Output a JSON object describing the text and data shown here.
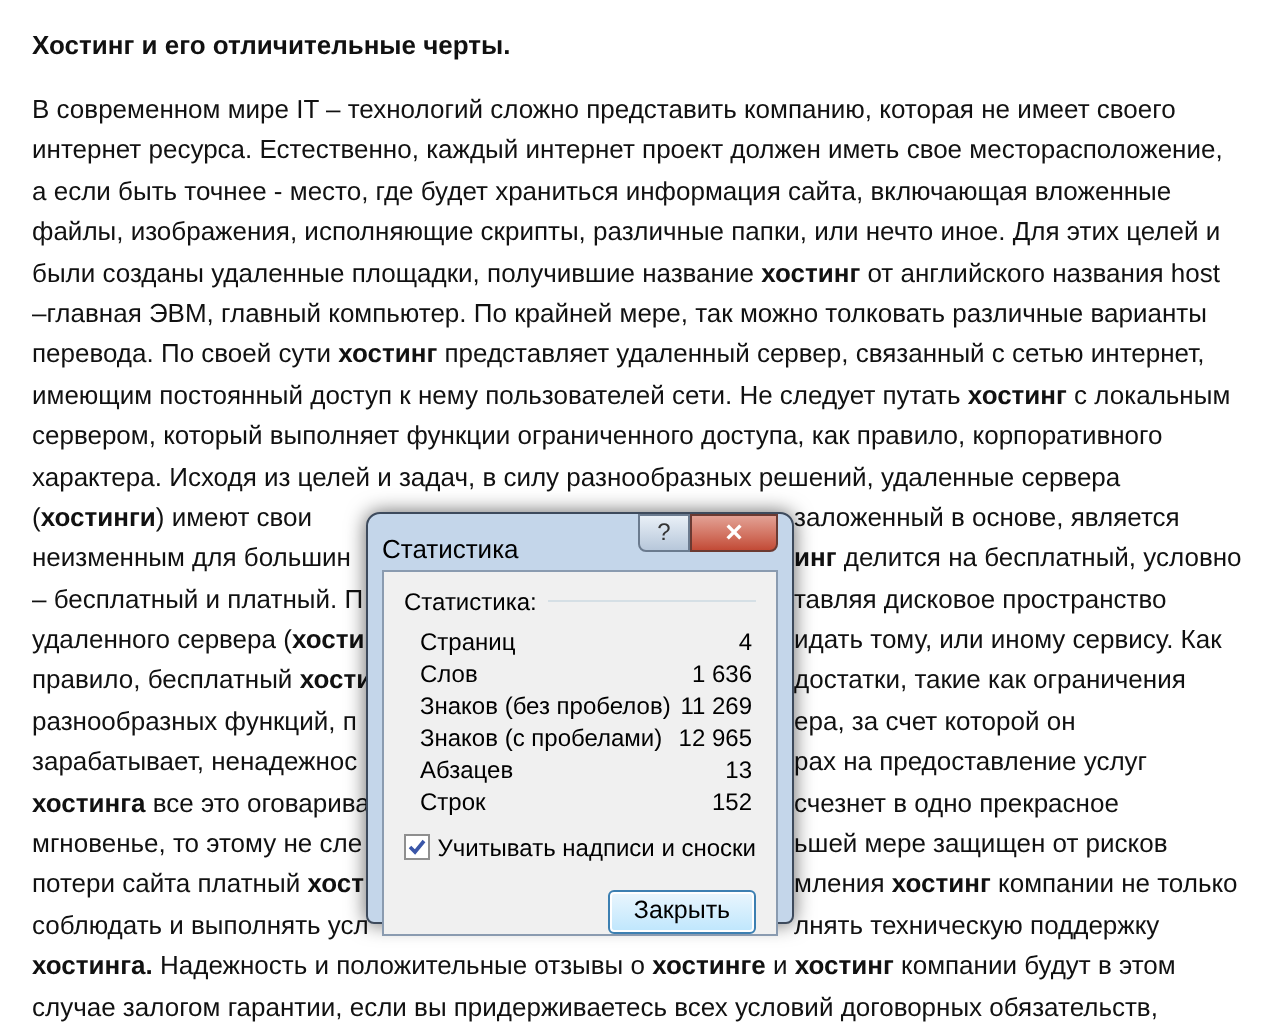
{
  "document": {
    "heading": "Хостинг и его отличительные черты.",
    "lines": [
      {
        "text": "В современном мире IT – технологий сложно представить компанию, которая не имеет своего"
      },
      {
        "text": "интернет ресурса. Естественно, каждый интернет проект должен иметь свое месторасположение,"
      },
      {
        "text": "а если быть точнее - место, где будет храниться информация сайта, включающая вложенные"
      },
      {
        "text": "файлы, изображения, исполняющие скрипты, различные папки, или нечто иное. Для этих целей и"
      },
      {
        "text": "были созданы удаленные площадки, получившие название **хостинг** от английского названия host"
      },
      {
        "text": "–главная ЭВМ, главный компьютер. По крайней мере, так можно толковать различные варианты"
      },
      {
        "text": "перевода. По своей сути **хостинг** представляет удаленный сервер, связанный с сетью интернет,"
      },
      {
        "text": "имеющим постоянный доступ к нему пользователей сети. Не следует путать **хостинг** с локальным"
      },
      {
        "text": "сервером, который выполняет функции ограниченного доступа, как правило, корпоративного"
      },
      {
        "text": "характера. Исходя из целей и задач, в силу разнообразных решений, удаленные сервера"
      },
      {
        "text": "(**хостинги**) имеют свои",
        "right": "заложенный в основе, является"
      },
      {
        "text": "неизменным для большин",
        "right": "**инг** делится на бесплатный, условно"
      },
      {
        "text": "– бесплатный и платный. П",
        "right": "тавляя дисковое пространство"
      },
      {
        "text": "удаленного сервера (**хости**",
        "right": "идать тому, или иному сервису. Как"
      },
      {
        "text": "правило, бесплатный **хости**",
        "right": "достатки, такие как ограничения"
      },
      {
        "text": "разнообразных функций, п",
        "right": "ера, за счет которой он"
      },
      {
        "text": "зарабатывает, ненадежнос",
        "right": "рах на предоставление услуг"
      },
      {
        "text": "**хостинга** все это оговарива",
        "right": "счезнет в одно прекрасное"
      },
      {
        "text": "мгновенье, то этому не сле",
        "right": "ьшей мере защищен от рисков"
      },
      {
        "text": "потери сайта платный **хост**",
        "right": "мления **хостинг** компании не только"
      },
      {
        "text": "соблюдать и выполнять усл",
        "right": "лнять техническую поддержку"
      },
      {
        "text": "**хостинга.** Надежность и положительные отзывы о **хостинге** и **хостинг** компании будут в этом"
      },
      {
        "text": "случае залогом гарантии, если вы придерживаетесь всех условий договорных обязательств,"
      }
    ]
  },
  "dialog": {
    "title": "Статистика",
    "help": "?",
    "close": "×",
    "group": "Статистика:",
    "stats": [
      {
        "label": "Страниц",
        "value": "4"
      },
      {
        "label": "Слов",
        "value": "1 636"
      },
      {
        "label": "Знаков (без пробелов)",
        "value": "11 269"
      },
      {
        "label": "Знаков (с пробелами)",
        "value": "12 965"
      },
      {
        "label": "Абзацев",
        "value": "13"
      },
      {
        "label": "Строк",
        "value": "152"
      }
    ],
    "checkbox": {
      "label": "Учитывать надписи и сноски",
      "checked": true
    },
    "button": "Закрыть"
  }
}
